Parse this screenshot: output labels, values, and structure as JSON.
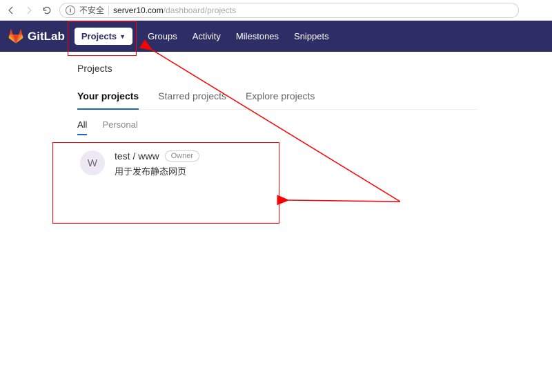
{
  "browser": {
    "security_label": "不安全",
    "url_host": "server10.com",
    "url_path": "/dashboard/projects"
  },
  "topnav": {
    "brand": "GitLab",
    "projects_btn": "Projects",
    "links": {
      "groups": "Groups",
      "activity": "Activity",
      "milestones": "Milestones",
      "snippets": "Snippets"
    }
  },
  "page": {
    "title": "Projects",
    "tabs": {
      "your": "Your projects",
      "starred": "Starred projects",
      "explore": "Explore projects"
    },
    "subtabs": {
      "all": "All",
      "personal": "Personal"
    }
  },
  "project": {
    "avatar_letter": "W",
    "path": "test / www",
    "role_badge": "Owner",
    "description": "用于发布静态网页"
  }
}
